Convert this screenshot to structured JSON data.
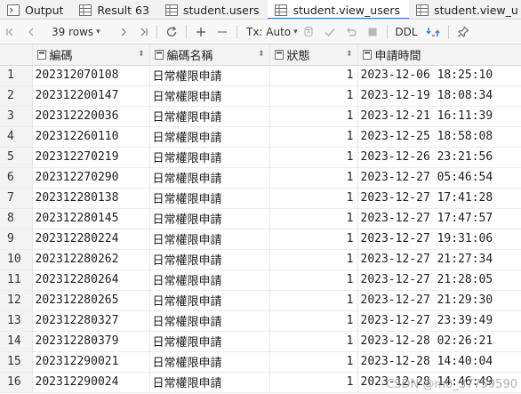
{
  "tabs": [
    {
      "label": "Output",
      "icon": "output-icon",
      "active": false
    },
    {
      "label": "Result 63",
      "icon": "table-icon",
      "active": false
    },
    {
      "label": "student.users",
      "icon": "table-icon",
      "active": false
    },
    {
      "label": "student.view_users",
      "icon": "table-icon",
      "active": true
    },
    {
      "label": "student.view_u",
      "icon": "table-icon",
      "active": false
    }
  ],
  "toolbar": {
    "rows_label": "39 rows",
    "tx_label": "Tx: Auto",
    "ddl_label": "DDL"
  },
  "columns": [
    {
      "label": "編碼"
    },
    {
      "label": "編碼名稱"
    },
    {
      "label": "狀態"
    },
    {
      "label": "申請時間"
    }
  ],
  "rows": [
    {
      "n": "1",
      "code": "202312070108",
      "name": "日常權限申請",
      "status": "1",
      "time": "2023-12-06 18:25:10"
    },
    {
      "n": "2",
      "code": "202312200147",
      "name": "日常權限申請",
      "status": "1",
      "time": "2023-12-19 18:08:34"
    },
    {
      "n": "3",
      "code": "202312220036",
      "name": "日常權限申請",
      "status": "1",
      "time": "2023-12-21 16:11:39"
    },
    {
      "n": "4",
      "code": "202312260110",
      "name": "日常權限申請",
      "status": "1",
      "time": "2023-12-25 18:58:08"
    },
    {
      "n": "5",
      "code": "202312270219",
      "name": "日常權限申請",
      "status": "1",
      "time": "2023-12-26 23:21:56"
    },
    {
      "n": "6",
      "code": "202312270290",
      "name": "日常權限申請",
      "status": "1",
      "time": "2023-12-27 05:46:54"
    },
    {
      "n": "7",
      "code": "202312280138",
      "name": "日常權限申請",
      "status": "1",
      "time": "2023-12-27 17:41:28"
    },
    {
      "n": "8",
      "code": "202312280145",
      "name": "日常權限申請",
      "status": "1",
      "time": "2023-12-27 17:47:57"
    },
    {
      "n": "9",
      "code": "202312280224",
      "name": "日常權限申請",
      "status": "1",
      "time": "2023-12-27 19:31:06"
    },
    {
      "n": "10",
      "code": "202312280262",
      "name": "日常權限申請",
      "status": "1",
      "time": "2023-12-27 21:27:34"
    },
    {
      "n": "11",
      "code": "202312280264",
      "name": "日常權限申請",
      "status": "1",
      "time": "2023-12-27 21:28:05"
    },
    {
      "n": "12",
      "code": "202312280265",
      "name": "日常權限申請",
      "status": "1",
      "time": "2023-12-27 21:29:30"
    },
    {
      "n": "13",
      "code": "202312280327",
      "name": "日常權限申請",
      "status": "1",
      "time": "2023-12-27 23:39:49"
    },
    {
      "n": "14",
      "code": "202312280379",
      "name": "日常權限申請",
      "status": "1",
      "time": "2023-12-28 02:26:21"
    },
    {
      "n": "15",
      "code": "202312290021",
      "name": "日常權限申請",
      "status": "1",
      "time": "2023-12-28 14:40:04"
    },
    {
      "n": "16",
      "code": "202312290024",
      "name": "日常權限申請",
      "status": "1",
      "time": "2023-12-28 14:46:49"
    }
  ],
  "watermark": "CSDN @m0_37759590",
  "colors": {
    "accent": "#3574f0",
    "header_bg": "#f3f3f3"
  }
}
